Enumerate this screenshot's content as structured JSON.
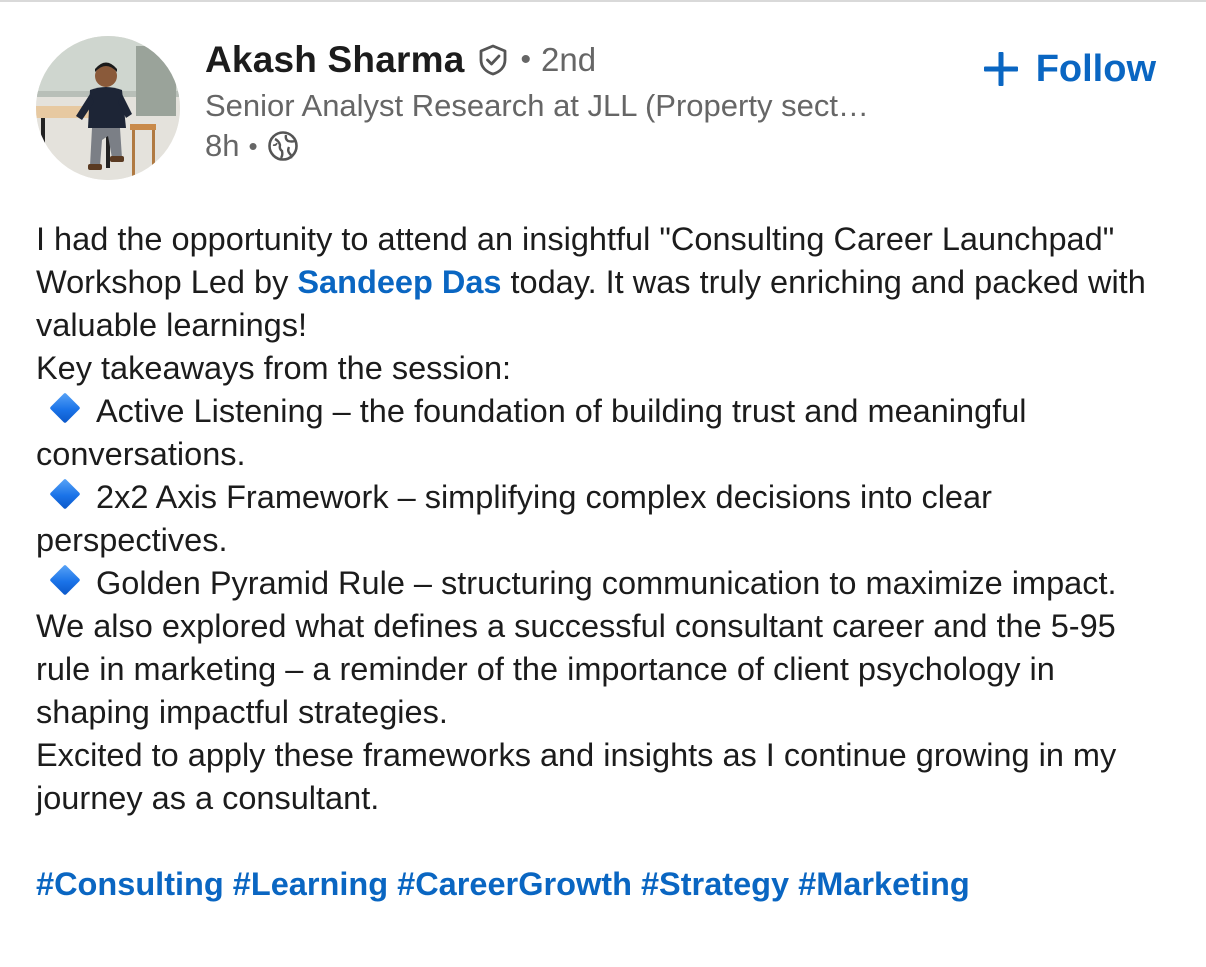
{
  "author": {
    "name": "Akash Sharma",
    "separator": "•",
    "degree": "2nd",
    "headline": "Senior Analyst Research at JLL (Property sect…",
    "time": "8h",
    "visibility_icon": "globe-icon"
  },
  "follow_button": {
    "icon": "plus-icon",
    "label": "Follow"
  },
  "post": {
    "intro_before_mention": "I had the opportunity to attend an insightful \"Consulting Career Launchpad\" Workshop Led by ",
    "mention": "Sandeep Das",
    "intro_after_mention": " today. It was truly enriching and packed with valuable learnings!",
    "takeaways_heading": "Key takeaways from the session:",
    "bullets": [
      "Active Listening – the foundation of building trust and meaningful conversations.",
      "2x2 Axis Framework – simplifying complex decisions into clear perspectives.",
      "Golden Pyramid Rule – structuring communication to maximize impact."
    ],
    "paragraph_2": "We also explored what defines a successful consultant career and the 5-95 rule in marketing – a reminder of the importance of client psychology in shaping impactful strategies.",
    "paragraph_3": "Excited to apply these frameworks and insights as I continue growing in my journey as a consultant.",
    "hashtags": [
      "#Consulting",
      "#Learning",
      "#CareerGrowth",
      "#Strategy",
      "#Marketing"
    ]
  },
  "colors": {
    "link_blue": "#0a66c2",
    "text_primary": "#1c1c1c",
    "text_secondary": "#666666",
    "bullet_diamond": "#1a73e8"
  }
}
